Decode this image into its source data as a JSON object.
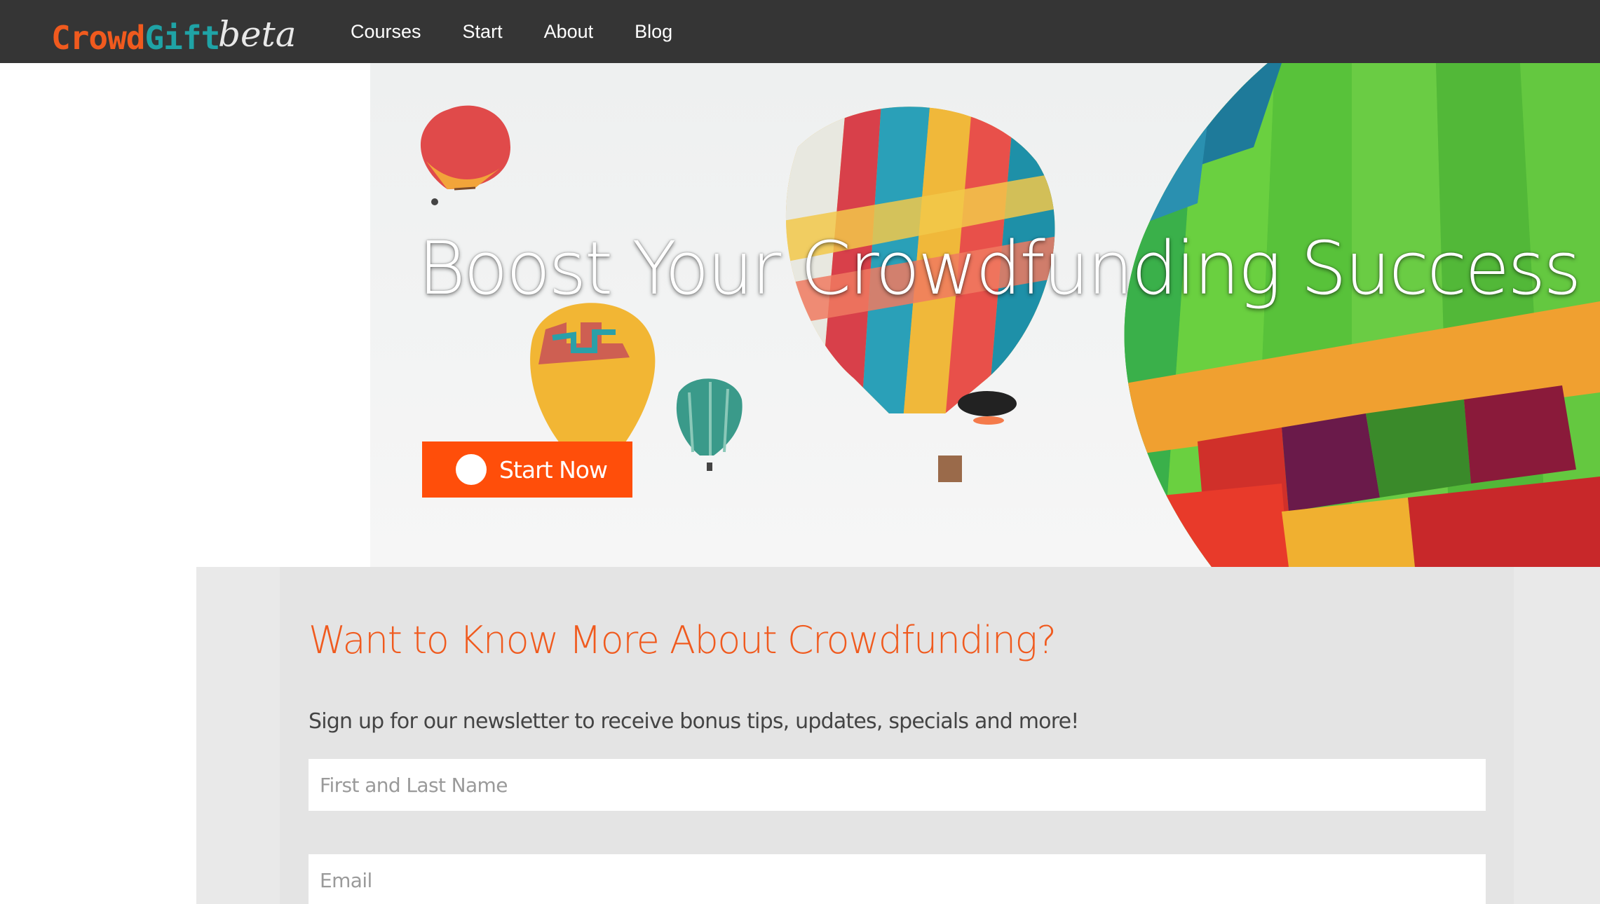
{
  "header": {
    "logo_part1": "Crowd",
    "logo_part2": "Gift",
    "logo_beta": "beta",
    "nav": [
      {
        "label": "Courses"
      },
      {
        "label": "Start"
      },
      {
        "label": "About"
      },
      {
        "label": "Blog"
      }
    ]
  },
  "hero": {
    "title": "Boost Your Crowdfunding Success",
    "cta_label": "Start Now",
    "cta_icon": "arrow-right-circle-icon"
  },
  "newsletter": {
    "title": "Want to Know More About Crowdfunding?",
    "subtitle": "Sign up for our newsletter to receive bonus tips, updates, specials and more!",
    "name_placeholder": "First and Last Name",
    "email_placeholder": "Email"
  },
  "colors": {
    "topbar": "#353535",
    "accent_orange": "#ff4e0a",
    "logo_teal": "#1fa3a6",
    "panel_gray": "#e4e4e4"
  }
}
